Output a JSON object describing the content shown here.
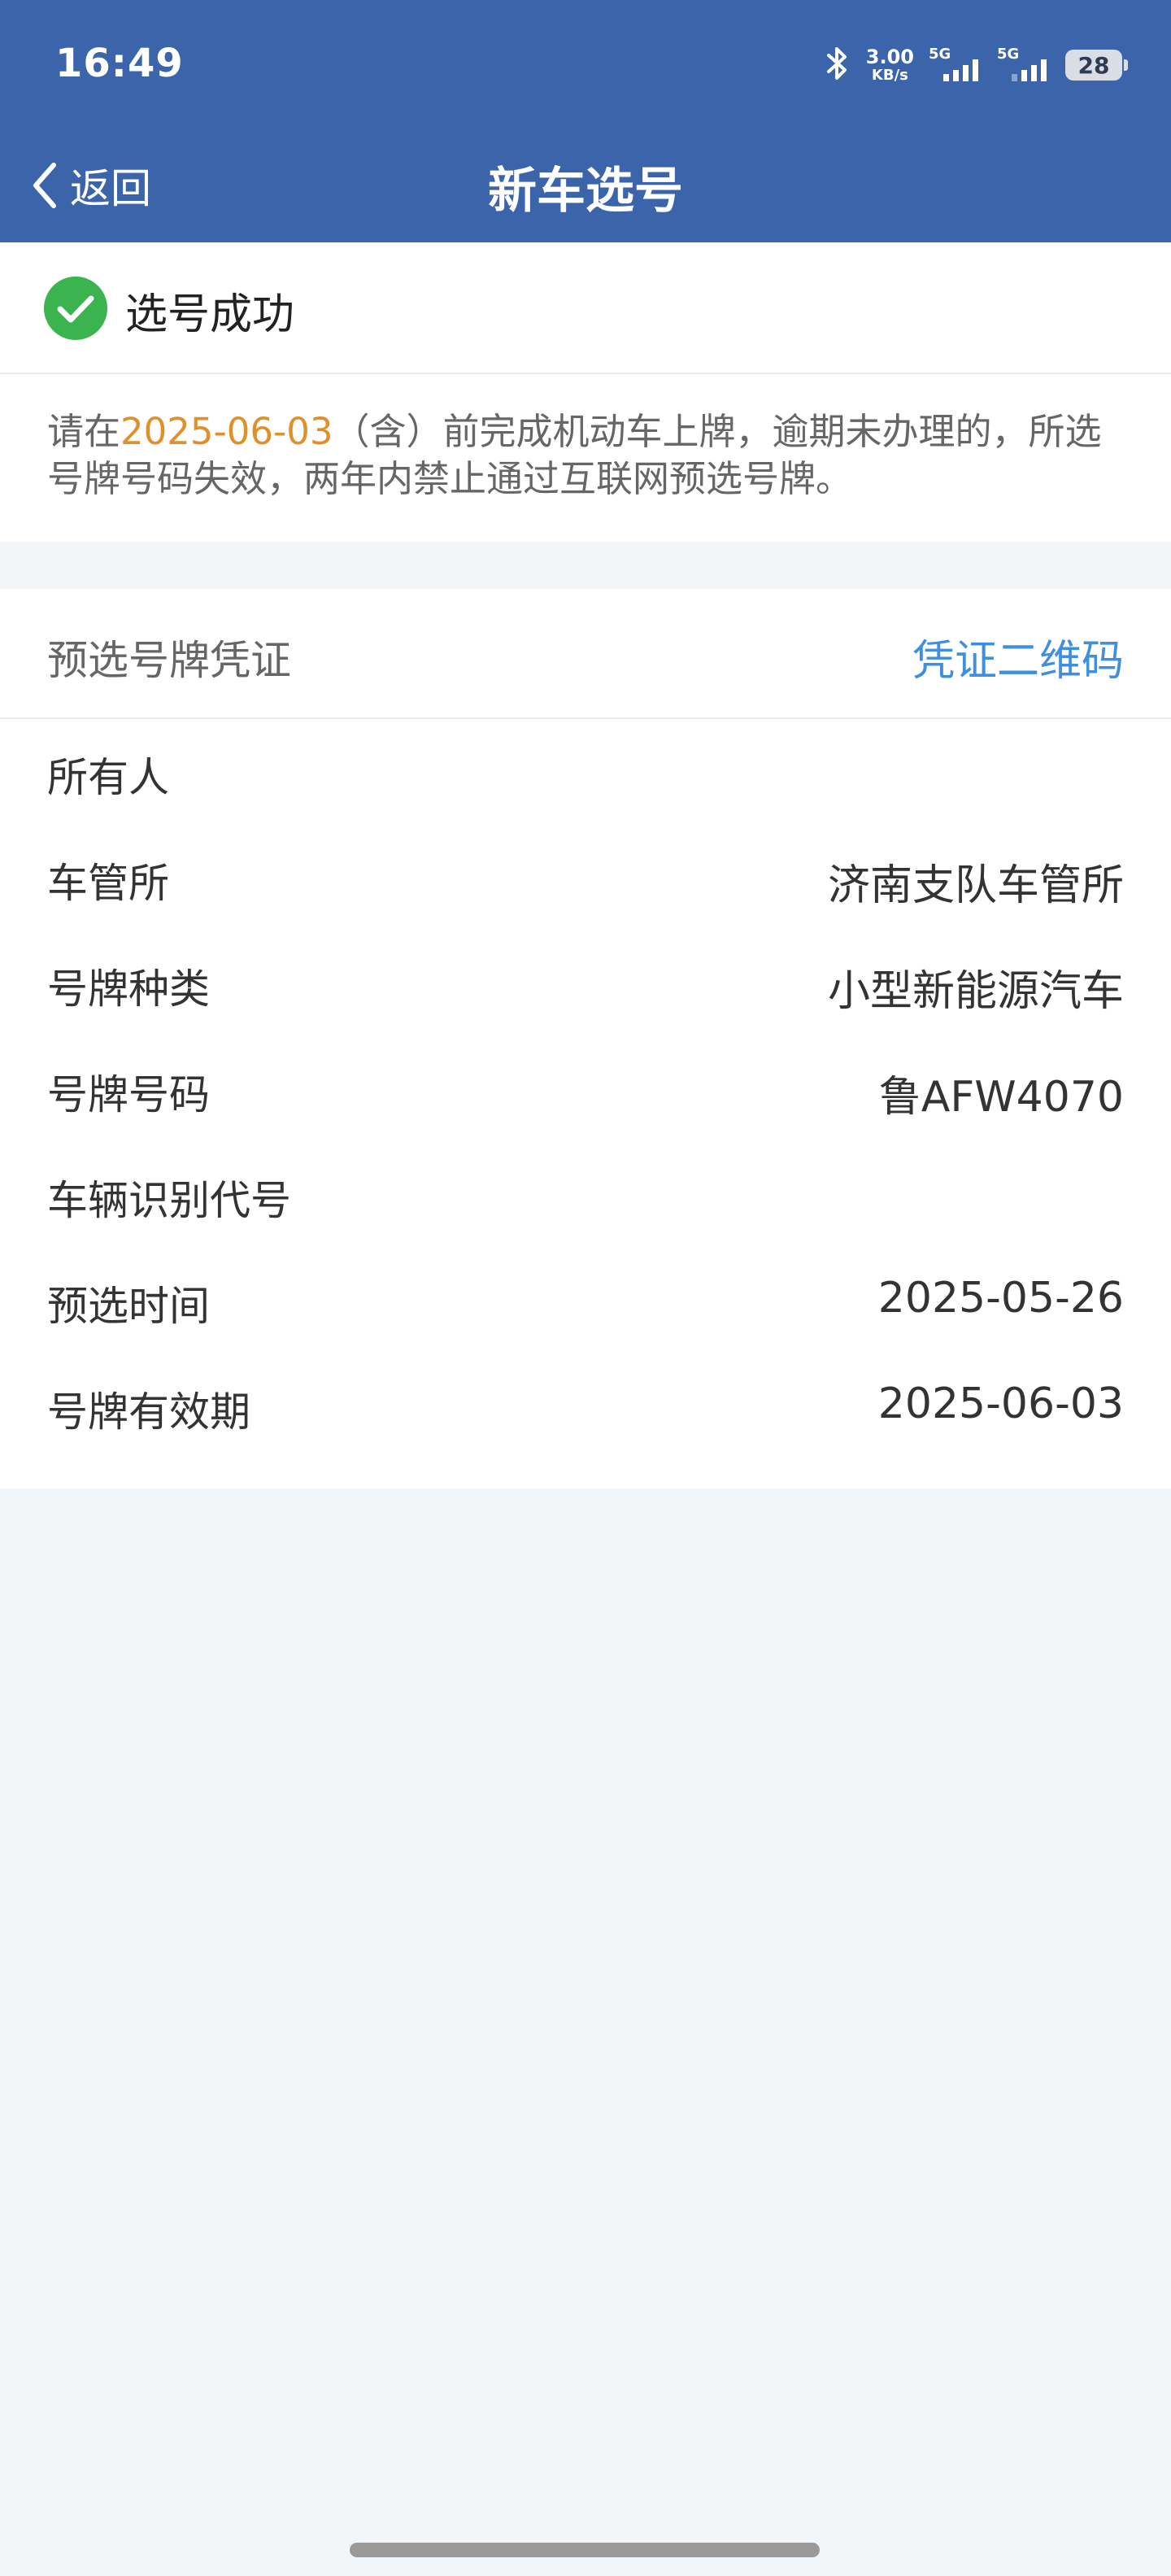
{
  "status_bar": {
    "time": "16:49",
    "net_speed_value": "3.00",
    "net_speed_unit": "KB/s",
    "sim1_label": "5G",
    "sim2_label": "5G",
    "battery": "28",
    "icons": [
      "bluetooth-icon",
      "signal-icon",
      "battery-icon"
    ]
  },
  "nav": {
    "back_label": "返回",
    "title": "新车选号"
  },
  "result": {
    "text": "选号成功",
    "icon": "check-circle-icon",
    "icon_color": "#3bb34e"
  },
  "notice": {
    "prefix": "请在",
    "date": "2025-06-03",
    "suffix": "（含）前完成机动车上牌，逾期未办理的，所选号牌号码失效，两年内禁止通过互联网预选号牌。",
    "date_color": "#e0902a"
  },
  "voucher": {
    "label": "预选号牌凭证",
    "link": "凭证二维码",
    "link_color": "#3e8fe0"
  },
  "details": [
    {
      "label": "所有人",
      "value": ""
    },
    {
      "label": "车管所",
      "value": "济南支队车管所"
    },
    {
      "label": "号牌种类",
      "value": "小型新能源汽车"
    },
    {
      "label": "号牌号码",
      "value": "鲁AFW4070"
    },
    {
      "label": "车辆识别代号",
      "value": ""
    },
    {
      "label": "预选时间",
      "value": "2025-05-26"
    },
    {
      "label": "号牌有效期",
      "value": "2025-06-03"
    }
  ],
  "theme": {
    "header_color": "#3c64ab",
    "background": "#f3f6f8"
  }
}
